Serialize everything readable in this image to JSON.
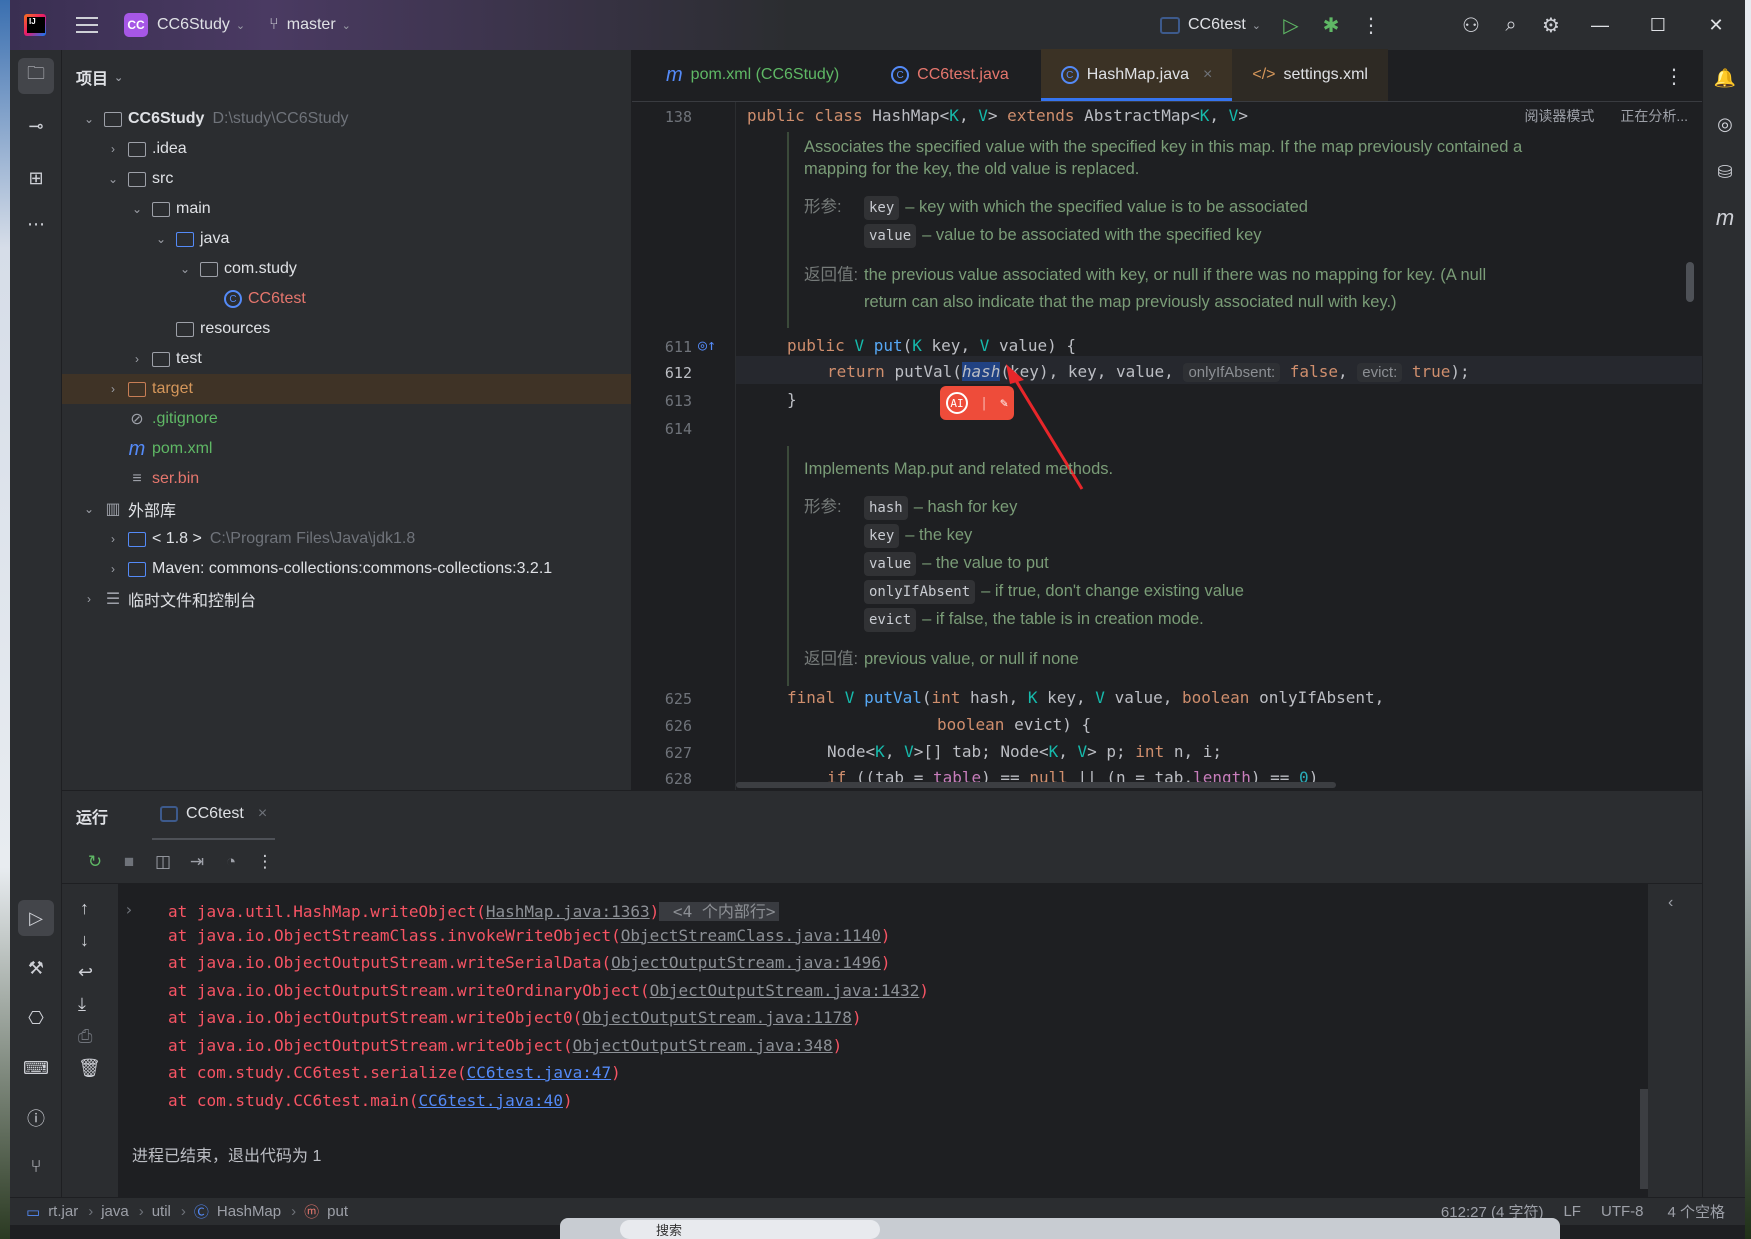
{
  "titlebar": {
    "project_badge": "CC",
    "project_name": "CC6Study",
    "branch": "master",
    "run_config": "CC6test"
  },
  "left_strip": [
    "project-icon",
    "commit-icon",
    "structure-icon",
    "more-icon",
    "run-icon",
    "build-icon",
    "services-icon",
    "terminal-icon",
    "problems-icon",
    "git-icon"
  ],
  "project": {
    "header": "项目",
    "tree": [
      {
        "label": "CC6Study",
        "path": "D:\\study\\CC6Study",
        "depth": 0,
        "arrow": "v",
        "bold": true
      },
      {
        "label": ".idea",
        "depth": 1,
        "arrow": ">"
      },
      {
        "label": "src",
        "depth": 1,
        "arrow": "v"
      },
      {
        "label": "main",
        "depth": 2,
        "arrow": "v"
      },
      {
        "label": "java",
        "depth": 3,
        "arrow": "v"
      },
      {
        "label": "com.study",
        "depth": 4,
        "arrow": "v"
      },
      {
        "label": "CC6test",
        "depth": 5,
        "arrow": ""
      },
      {
        "label": "resources",
        "depth": 3,
        "arrow": ""
      },
      {
        "label": "test",
        "depth": 2,
        "arrow": ">"
      },
      {
        "label": "target",
        "depth": 1,
        "arrow": ">"
      },
      {
        "label": ".gitignore",
        "depth": 1,
        "arrow": ""
      },
      {
        "label": "pom.xml",
        "depth": 1,
        "arrow": ""
      },
      {
        "label": "ser.bin",
        "depth": 1,
        "arrow": ""
      },
      {
        "label": "外部库",
        "depth": 0,
        "arrow": "v"
      },
      {
        "label": "< 1.8 >",
        "path": "C:\\Program Files\\Java\\jdk1.8",
        "depth": 1,
        "arrow": ">"
      },
      {
        "label": "Maven: commons-collections:commons-collections:3.2.1",
        "depth": 1,
        "arrow": ">"
      },
      {
        "label": "临时文件和控制台",
        "depth": 0,
        "arrow": ">"
      }
    ]
  },
  "tabs": [
    {
      "label": "pom.xml (CC6Study)",
      "icon": "maven-icon"
    },
    {
      "label": "CC6test.java",
      "icon": "class-icon"
    },
    {
      "label": "HashMap.java",
      "icon": "class-icon",
      "active": true,
      "close": "×"
    },
    {
      "label": "settings.xml",
      "icon": "xml-icon"
    }
  ],
  "editor": {
    "reader_mode": "阅读器模式",
    "analyzing": "正在分析...",
    "line_138": {
      "num": "138",
      "kw1": "public class ",
      "name": "HashMap",
      "rest": " extends AbstractMap"
    },
    "doc1": {
      "desc1": "Associates the specified value with the specified key in this map. If the map previously contained a",
      "desc2": "mapping for the key, the old value is replaced.",
      "params_label": "形参:",
      "params": [
        {
          "name": "key",
          "desc": "– key with which the specified value is to be associated"
        },
        {
          "name": "value",
          "desc": "– value to be associated with the specified key"
        }
      ],
      "returns_label": "返回值:",
      "returns1": "the previous value associated with key, or null if there was no mapping for key. (A null",
      "returns2": "return can also indicate that the map previously associated null with key.)"
    },
    "lines": [
      {
        "num": "611"
      },
      {
        "num": "612"
      },
      {
        "num": "613"
      },
      {
        "num": "614"
      },
      {
        "num": "625"
      },
      {
        "num": "626"
      },
      {
        "num": "627"
      },
      {
        "num": "628"
      }
    ],
    "inlay_only_if_absent": "onlyIfAbsent:",
    "inlay_evict": "evict:",
    "doc2": {
      "desc": "Implements Map.put and related methods.",
      "params_label": "形参:",
      "params": [
        {
          "name": "hash",
          "desc": "– hash for key"
        },
        {
          "name": "key",
          "desc": "– the key"
        },
        {
          "name": "value",
          "desc": "– the value to put"
        },
        {
          "name": "onlyIfAbsent",
          "desc": "– if true, don't change existing value"
        },
        {
          "name": "evict",
          "desc": "– if false, the table is in creation mode."
        }
      ],
      "returns_label": "返回值:",
      "returns": "previous value, or null if none"
    },
    "ai_label": "AI"
  },
  "run": {
    "title": "运行",
    "tab": "CC6test",
    "console": [
      {
        "pre": "at java.util.HashMap.writeObject(",
        "link": "HashMap.java:1363",
        "post": ")",
        "fold": "<4 个内部行>"
      },
      {
        "pre": "at java.io.ObjectStreamClass.invokeWriteObject(",
        "link": "ObjectStreamClass.java:1140",
        "post": ")"
      },
      {
        "pre": "at java.io.ObjectOutputStream.writeSerialData(",
        "link": "ObjectOutputStream.java:1496",
        "post": ")"
      },
      {
        "pre": "at java.io.ObjectOutputStream.writeOrdinaryObject(",
        "link": "ObjectOutputStream.java:1432",
        "post": ")"
      },
      {
        "pre": "at java.io.ObjectOutputStream.writeObject0(",
        "link": "ObjectOutputStream.java:1178",
        "post": ")"
      },
      {
        "pre": "at java.io.ObjectOutputStream.writeObject(",
        "link": "ObjectOutputStream.java:348",
        "post": ")"
      },
      {
        "pre": "at com.study.CC6test.serialize(",
        "link": "CC6test.java:47",
        "post": ")",
        "blue": true
      },
      {
        "pre": "at com.study.CC6test.main(",
        "link": "CC6test.java:40",
        "post": ")",
        "blue": true
      }
    ],
    "exit": "进程已结束，退出代码为 1"
  },
  "status": {
    "crumbs": [
      "rt.jar",
      "java",
      "util",
      "HashMap",
      "put"
    ],
    "position": "612:27 (4 字符)",
    "line_sep": "LF",
    "encoding": "UTF-8",
    "indent": "4 个空格"
  },
  "taskbar": {
    "search": "搜索"
  }
}
